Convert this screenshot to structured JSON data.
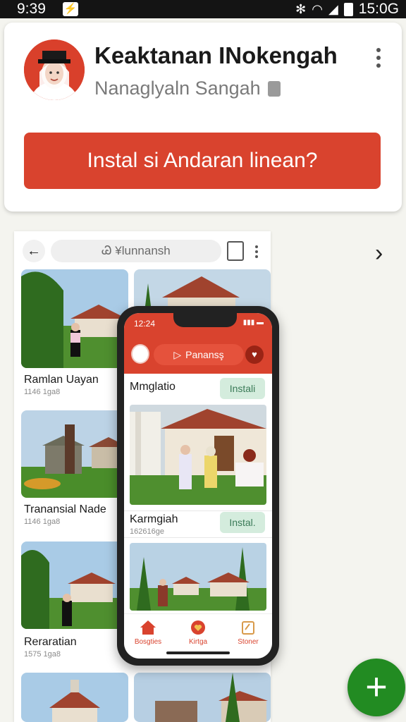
{
  "status_bar": {
    "time": "9:39",
    "right_time": "15:0G"
  },
  "header": {
    "title": "Keaktanan INokengah",
    "subtitle": "Nanaglyaln Sangah",
    "install_button": "Instal si Andaran linean?"
  },
  "panel": {
    "search_text": "Ꮚ ¥lunnansh",
    "items": [
      {
        "title": "Ramlan Uayan",
        "sub": "1146 1ga8"
      },
      {
        "title": "Tranansial Nade",
        "sub": "1146 1ga8"
      },
      {
        "title": "Reraratian",
        "sub": "1575 1ga8"
      }
    ]
  },
  "phone": {
    "time": "12:24",
    "search_text": "Panansş",
    "rows": [
      {
        "title": "Mmglatio",
        "sub": "",
        "install": "Instali"
      },
      {
        "title": "Karmgiah",
        "sub": "162616ge",
        "install": "Instal."
      }
    ],
    "nav": [
      {
        "label": "Bosgties",
        "icon": "home-icon"
      },
      {
        "label": "Kirtga",
        "icon": "heart-icon"
      },
      {
        "label": "Stoner",
        "icon": "store-icon"
      }
    ]
  },
  "colors": {
    "accent": "#d9432e",
    "fab": "#228b22",
    "install_soft": "#d4ecdd"
  },
  "fab_label": "+"
}
